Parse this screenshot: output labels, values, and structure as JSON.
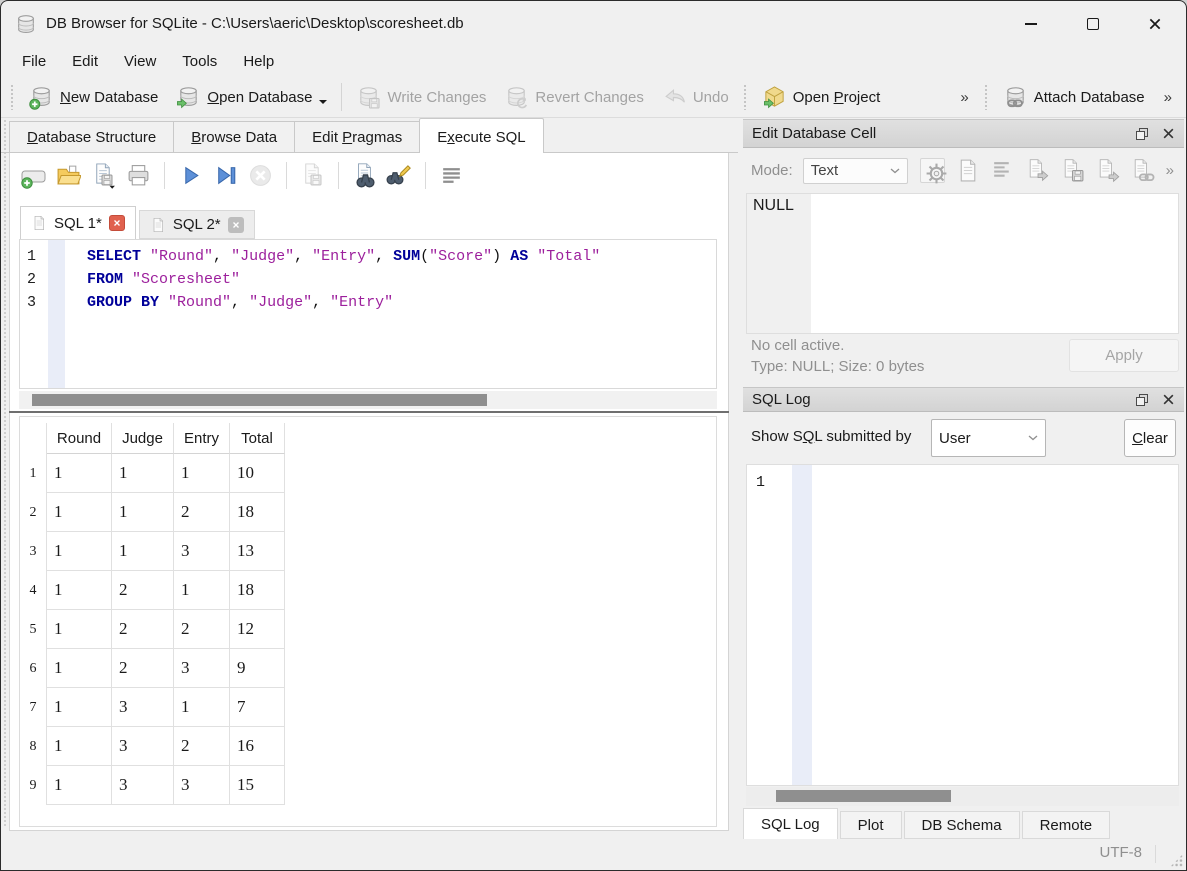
{
  "window": {
    "title": "DB Browser for SQLite - C:\\Users\\aeric\\Desktop\\scoresheet.db"
  },
  "menubar": {
    "items": [
      "File",
      "Edit",
      "View",
      "Tools",
      "Help"
    ]
  },
  "toolbar": {
    "overflow_indicator": "»",
    "buttons": [
      {
        "label": "New Database",
        "u": 0,
        "enabled": true
      },
      {
        "label": "Open Database",
        "u": 0,
        "enabled": true
      },
      {
        "label": "Write Changes",
        "u": -1,
        "enabled": false
      },
      {
        "label": "Revert Changes",
        "u": -1,
        "enabled": false
      },
      {
        "label": "Undo",
        "u": -1,
        "enabled": false
      },
      {
        "label": "Open Project",
        "u": 5,
        "enabled": true
      },
      {
        "label": "Attach Database",
        "u": -1,
        "enabled": true
      }
    ]
  },
  "main_tabs": [
    {
      "label": "Database Structure",
      "u": 0,
      "active": false
    },
    {
      "label": "Browse Data",
      "u": 0,
      "active": false
    },
    {
      "label": "Edit Pragmas",
      "u": 5,
      "active": false
    },
    {
      "label": "Execute SQL",
      "u": 1,
      "active": true
    }
  ],
  "sql_editor": {
    "tabs": [
      {
        "label": "SQL 1*",
        "active": true
      },
      {
        "label": "SQL 2*",
        "active": false
      }
    ],
    "lines": [
      {
        "number": "1",
        "tokens": [
          [
            "kw",
            "SELECT"
          ],
          [
            "pl",
            " "
          ],
          [
            "id",
            "\"Round\""
          ],
          [
            "pl",
            ", "
          ],
          [
            "id",
            "\"Judge\""
          ],
          [
            "pl",
            ", "
          ],
          [
            "id",
            "\"Entry\""
          ],
          [
            "pl",
            ", "
          ],
          [
            "kw",
            "SUM"
          ],
          [
            "pl",
            "("
          ],
          [
            "id",
            "\"Score\""
          ],
          [
            "pl",
            ") "
          ],
          [
            "kw",
            "AS"
          ],
          [
            "pl",
            " "
          ],
          [
            "id",
            "\"Total\""
          ]
        ]
      },
      {
        "number": "2",
        "tokens": [
          [
            "kw",
            "FROM"
          ],
          [
            "pl",
            " "
          ],
          [
            "id",
            "\"Scoresheet\""
          ]
        ]
      },
      {
        "number": "3",
        "tokens": [
          [
            "kw",
            "GROUP BY"
          ],
          [
            "pl",
            " "
          ],
          [
            "id",
            "\"Round\""
          ],
          [
            "pl",
            ", "
          ],
          [
            "id",
            "\"Judge\""
          ],
          [
            "pl",
            ", "
          ],
          [
            "id",
            "\"Entry\""
          ]
        ]
      }
    ]
  },
  "results": {
    "columns": [
      "Round",
      "Judge",
      "Entry",
      "Total"
    ],
    "rows": [
      {
        "n": "1",
        "cells": [
          "1",
          "1",
          "1",
          "10"
        ]
      },
      {
        "n": "2",
        "cells": [
          "1",
          "1",
          "2",
          "18"
        ]
      },
      {
        "n": "3",
        "cells": [
          "1",
          "1",
          "3",
          "13"
        ]
      },
      {
        "n": "4",
        "cells": [
          "1",
          "2",
          "1",
          "18"
        ]
      },
      {
        "n": "5",
        "cells": [
          "1",
          "2",
          "2",
          "12"
        ]
      },
      {
        "n": "6",
        "cells": [
          "1",
          "2",
          "3",
          "9"
        ]
      },
      {
        "n": "7",
        "cells": [
          "1",
          "3",
          "1",
          "7"
        ]
      },
      {
        "n": "8",
        "cells": [
          "1",
          "3",
          "2",
          "16"
        ]
      },
      {
        "n": "9",
        "cells": [
          "1",
          "3",
          "3",
          "15"
        ]
      }
    ]
  },
  "edit_cell_panel": {
    "title": "Edit Database Cell",
    "mode_label": "Mode:",
    "mode_value": "Text",
    "overflow_indicator": "»",
    "content": "NULL",
    "status_line1": "No cell active.",
    "status_line2": "Type: NULL; Size: 0 bytes",
    "apply_label": "Apply"
  },
  "sql_log_panel": {
    "title": "SQL Log",
    "filter": {
      "label": "Show SQL submitted by",
      "u": 6
    },
    "filter_value": "User",
    "clear": {
      "label": "Clear",
      "u": 0
    },
    "line_number": "1"
  },
  "bottom_tabs": [
    {
      "label": "SQL Log",
      "active": true
    },
    {
      "label": "Plot",
      "active": false
    },
    {
      "label": "DB Schema",
      "active": false
    },
    {
      "label": "Remote",
      "active": false
    }
  ],
  "status_bar": {
    "encoding": "UTF-8"
  },
  "icons": {
    "titlebar": "database-icon",
    "window": [
      "minimize-icon",
      "maximize-icon",
      "close-icon"
    ],
    "toolbar": [
      "database-new-icon",
      "database-open-icon",
      "database-write-icon",
      "database-revert-icon",
      "undo-icon",
      "project-open-icon",
      "database-attach-icon"
    ],
    "sql_toolbar": [
      "new-sql-tab-icon",
      "open-sql-file-icon",
      "save-sql-file-icon",
      "print-icon",
      "execute-all-icon",
      "execute-current-line-icon",
      "stop-icon",
      "save-results-icon",
      "find-icon",
      "find-replace-icon",
      "word-wrap-icon"
    ],
    "cell_toolbar": [
      "settings-icon",
      "text-mode-icon",
      "justify-icon",
      "import-icon",
      "save-icon",
      "export-icon",
      "link-icon"
    ],
    "dock": [
      "float-icon",
      "close-icon"
    ]
  },
  "colors": {
    "keyword": "#000099",
    "identifier": "#9c1f9c",
    "close_tab_red": "#e0614e",
    "gutter_blue": "#e9edf8",
    "disabled_text": "#a3a3a3"
  }
}
